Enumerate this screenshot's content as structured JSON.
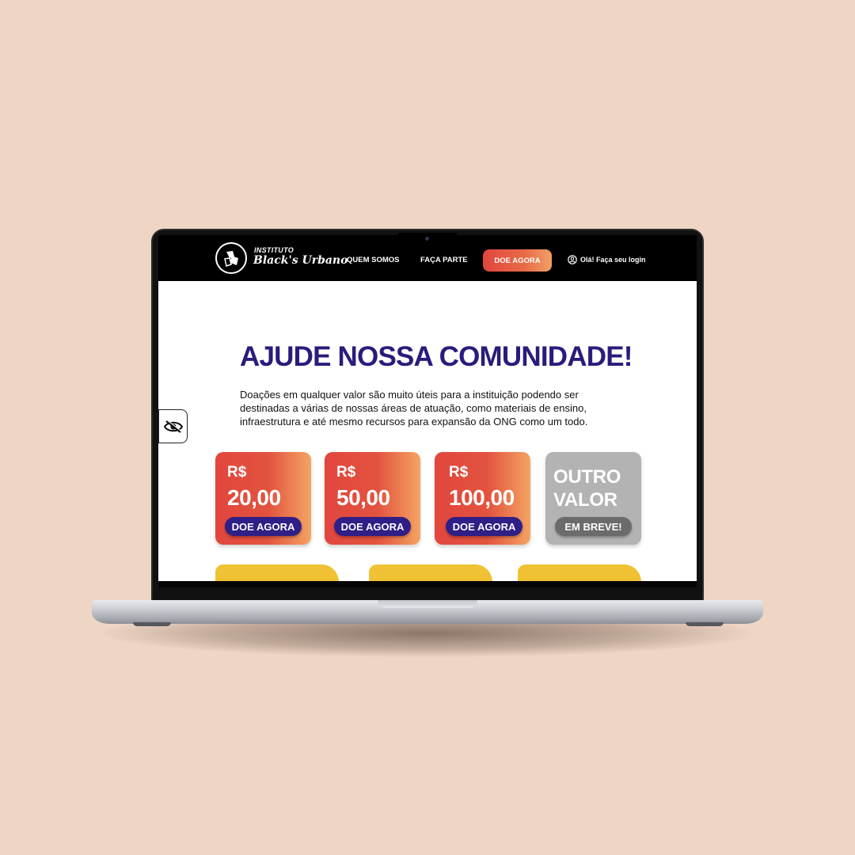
{
  "colors": {
    "background": "#eed5c4",
    "navbar": "#000000",
    "title": "#2a1b7c",
    "cta_gradient_start": "#e2463d",
    "cta_gradient_end": "#f4a463",
    "card_button": "#2f1f86",
    "disabled_card": "#b3b3b3",
    "accent_yellow": "#f0c233"
  },
  "navbar": {
    "logo_line1": "INSTITUTO",
    "logo_line2": "Black's Urbano",
    "links": [
      "QUEM SOMOS",
      "FAÇA PARTE"
    ],
    "cta_label": "DOE AGORA",
    "login_label": "Olá! Faça seu login",
    "login_icon": "user-circle-icon"
  },
  "hero": {
    "title": "AJUDE NOSSA COMUNIDADE!",
    "description": "Doações em qualquer valor são muito úteis para a instituição podendo ser destinadas a várias de nossas áreas de atuação, como materiais de ensino, infraestrutura e até mesmo recursos para expansão da ONG como um todo."
  },
  "accessibility": {
    "icon": "eye-slash-icon"
  },
  "donation_cards": [
    {
      "currency": "R$",
      "amount": "20,00",
      "button": "DOE AGORA"
    },
    {
      "currency": "R$",
      "amount": "50,00",
      "button": "DOE AGORA"
    },
    {
      "currency": "R$",
      "amount": "100,00",
      "button": "DOE AGORA"
    }
  ],
  "other_value_card": {
    "label": "OUTRO VALOR",
    "button": "EM BREVE!"
  }
}
